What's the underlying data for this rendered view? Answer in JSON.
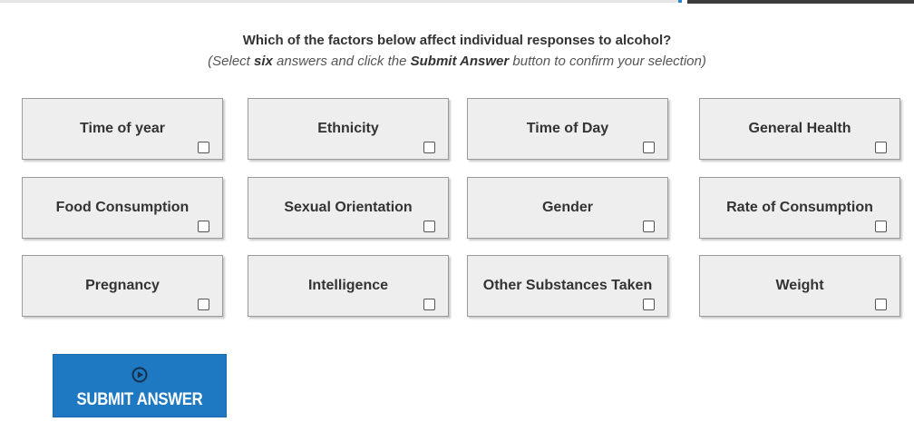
{
  "question": {
    "title": "Which of the factors below affect individual responses to alcohol?",
    "instruction_open": "(Select ",
    "instruction_count": "six",
    "instruction_mid": " answers and click the ",
    "instruction_button_ref": "Submit Answer",
    "instruction_close": " button to confirm your selection)"
  },
  "options": [
    {
      "label": "Time of year",
      "checked": false
    },
    {
      "label": "Ethnicity",
      "checked": false
    },
    {
      "label": "Time of Day",
      "checked": false
    },
    {
      "label": "General Health",
      "checked": false
    },
    {
      "label": "Food Consumption",
      "checked": false
    },
    {
      "label": "Sexual Orientation",
      "checked": false
    },
    {
      "label": "Gender",
      "checked": false
    },
    {
      "label": "Rate of Consumption",
      "checked": false
    },
    {
      "label": "Pregnancy",
      "checked": false
    },
    {
      "label": "Intelligence",
      "checked": false
    },
    {
      "label": "Other Substances Taken",
      "checked": false
    },
    {
      "label": "Weight",
      "checked": false
    }
  ],
  "submit": {
    "label": "SUBMIT ANSWER",
    "icon": "play-circle-icon"
  },
  "colors": {
    "accent": "#1f79c2",
    "option_background": "#eeeeee",
    "text": "#333333"
  }
}
